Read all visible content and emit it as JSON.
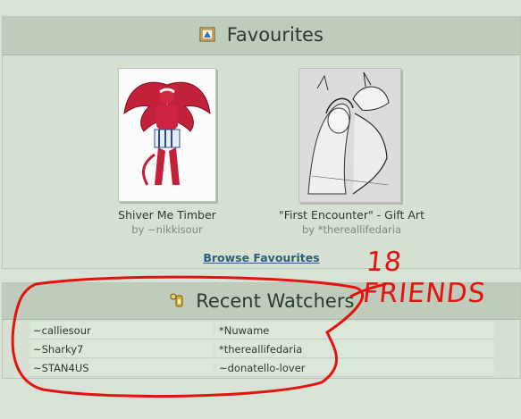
{
  "favourites": {
    "title": "Favourites",
    "items": [
      {
        "title": "Shiver Me Timber",
        "by": "by ~nikkisour"
      },
      {
        "title": "\"First Encounter\" - Gift Art",
        "by": "by *thereallifedaria"
      }
    ],
    "browse_label": "Browse Favourites"
  },
  "watchers": {
    "title": "Recent Watchers",
    "rows": [
      [
        "~calliesour",
        "*Nuwame"
      ],
      [
        "~Sharky7",
        "*thereallifedaria"
      ],
      [
        "~STAN4US",
        "~donatello-lover"
      ]
    ]
  },
  "annotation": {
    "text": "18 FRIENDS",
    "color": "#e3140f"
  }
}
